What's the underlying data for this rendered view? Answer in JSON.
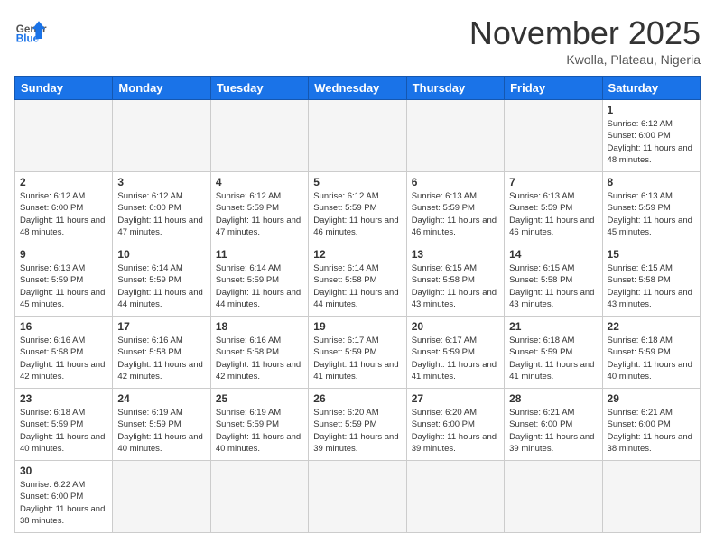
{
  "header": {
    "logo_general": "General",
    "logo_blue": "Blue",
    "month_title": "November 2025",
    "subtitle": "Kwolla, Plateau, Nigeria"
  },
  "days_of_week": [
    "Sunday",
    "Monday",
    "Tuesday",
    "Wednesday",
    "Thursday",
    "Friday",
    "Saturday"
  ],
  "weeks": [
    [
      {
        "day": "",
        "empty": true
      },
      {
        "day": "",
        "empty": true
      },
      {
        "day": "",
        "empty": true
      },
      {
        "day": "",
        "empty": true
      },
      {
        "day": "",
        "empty": true
      },
      {
        "day": "",
        "empty": true
      },
      {
        "day": "1",
        "sunrise": "6:12 AM",
        "sunset": "6:00 PM",
        "daylight": "11 hours and 48 minutes."
      }
    ],
    [
      {
        "day": "2",
        "sunrise": "6:12 AM",
        "sunset": "6:00 PM",
        "daylight": "11 hours and 48 minutes."
      },
      {
        "day": "3",
        "sunrise": "6:12 AM",
        "sunset": "6:00 PM",
        "daylight": "11 hours and 47 minutes."
      },
      {
        "day": "4",
        "sunrise": "6:12 AM",
        "sunset": "5:59 PM",
        "daylight": "11 hours and 47 minutes."
      },
      {
        "day": "5",
        "sunrise": "6:12 AM",
        "sunset": "5:59 PM",
        "daylight": "11 hours and 46 minutes."
      },
      {
        "day": "6",
        "sunrise": "6:13 AM",
        "sunset": "5:59 PM",
        "daylight": "11 hours and 46 minutes."
      },
      {
        "day": "7",
        "sunrise": "6:13 AM",
        "sunset": "5:59 PM",
        "daylight": "11 hours and 46 minutes."
      },
      {
        "day": "8",
        "sunrise": "6:13 AM",
        "sunset": "5:59 PM",
        "daylight": "11 hours and 45 minutes."
      }
    ],
    [
      {
        "day": "9",
        "sunrise": "6:13 AM",
        "sunset": "5:59 PM",
        "daylight": "11 hours and 45 minutes."
      },
      {
        "day": "10",
        "sunrise": "6:14 AM",
        "sunset": "5:59 PM",
        "daylight": "11 hours and 44 minutes."
      },
      {
        "day": "11",
        "sunrise": "6:14 AM",
        "sunset": "5:59 PM",
        "daylight": "11 hours and 44 minutes."
      },
      {
        "day": "12",
        "sunrise": "6:14 AM",
        "sunset": "5:58 PM",
        "daylight": "11 hours and 44 minutes."
      },
      {
        "day": "13",
        "sunrise": "6:15 AM",
        "sunset": "5:58 PM",
        "daylight": "11 hours and 43 minutes."
      },
      {
        "day": "14",
        "sunrise": "6:15 AM",
        "sunset": "5:58 PM",
        "daylight": "11 hours and 43 minutes."
      },
      {
        "day": "15",
        "sunrise": "6:15 AM",
        "sunset": "5:58 PM",
        "daylight": "11 hours and 43 minutes."
      }
    ],
    [
      {
        "day": "16",
        "sunrise": "6:16 AM",
        "sunset": "5:58 PM",
        "daylight": "11 hours and 42 minutes."
      },
      {
        "day": "17",
        "sunrise": "6:16 AM",
        "sunset": "5:58 PM",
        "daylight": "11 hours and 42 minutes."
      },
      {
        "day": "18",
        "sunrise": "6:16 AM",
        "sunset": "5:58 PM",
        "daylight": "11 hours and 42 minutes."
      },
      {
        "day": "19",
        "sunrise": "6:17 AM",
        "sunset": "5:59 PM",
        "daylight": "11 hours and 41 minutes."
      },
      {
        "day": "20",
        "sunrise": "6:17 AM",
        "sunset": "5:59 PM",
        "daylight": "11 hours and 41 minutes."
      },
      {
        "day": "21",
        "sunrise": "6:18 AM",
        "sunset": "5:59 PM",
        "daylight": "11 hours and 41 minutes."
      },
      {
        "day": "22",
        "sunrise": "6:18 AM",
        "sunset": "5:59 PM",
        "daylight": "11 hours and 40 minutes."
      }
    ],
    [
      {
        "day": "23",
        "sunrise": "6:18 AM",
        "sunset": "5:59 PM",
        "daylight": "11 hours and 40 minutes."
      },
      {
        "day": "24",
        "sunrise": "6:19 AM",
        "sunset": "5:59 PM",
        "daylight": "11 hours and 40 minutes."
      },
      {
        "day": "25",
        "sunrise": "6:19 AM",
        "sunset": "5:59 PM",
        "daylight": "11 hours and 40 minutes."
      },
      {
        "day": "26",
        "sunrise": "6:20 AM",
        "sunset": "5:59 PM",
        "daylight": "11 hours and 39 minutes."
      },
      {
        "day": "27",
        "sunrise": "6:20 AM",
        "sunset": "6:00 PM",
        "daylight": "11 hours and 39 minutes."
      },
      {
        "day": "28",
        "sunrise": "6:21 AM",
        "sunset": "6:00 PM",
        "daylight": "11 hours and 39 minutes."
      },
      {
        "day": "29",
        "sunrise": "6:21 AM",
        "sunset": "6:00 PM",
        "daylight": "11 hours and 38 minutes."
      }
    ],
    [
      {
        "day": "30",
        "sunrise": "6:22 AM",
        "sunset": "6:00 PM",
        "daylight": "11 hours and 38 minutes."
      },
      {
        "day": "",
        "empty": true
      },
      {
        "day": "",
        "empty": true
      },
      {
        "day": "",
        "empty": true
      },
      {
        "day": "",
        "empty": true
      },
      {
        "day": "",
        "empty": true
      },
      {
        "day": "",
        "empty": true
      }
    ]
  ]
}
